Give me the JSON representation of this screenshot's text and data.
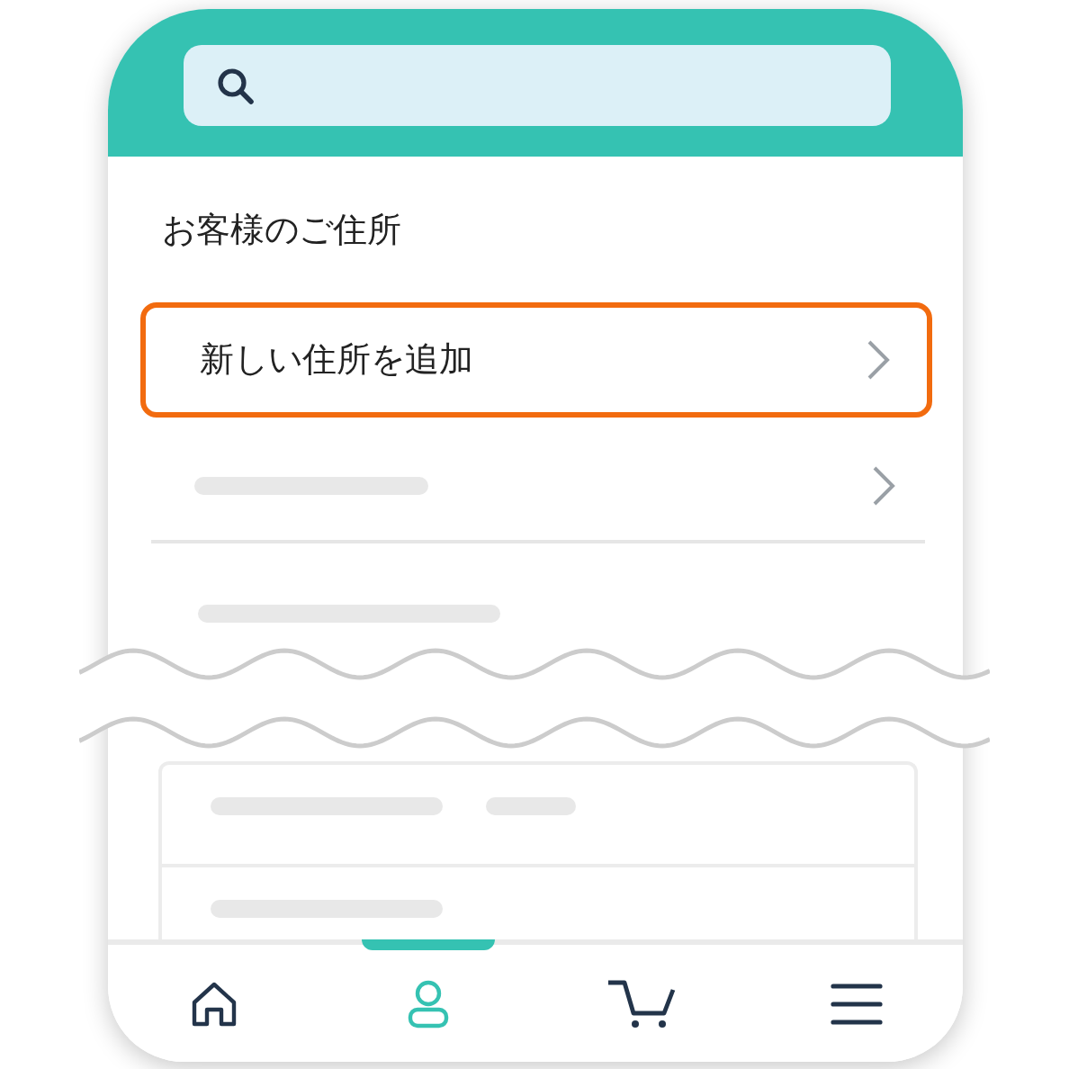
{
  "section_title": "お客様のご住所",
  "add_address_row": {
    "label": "新しい住所を追加",
    "highlighted": true
  },
  "bottom_nav": [
    {
      "kind": "home",
      "selected": false
    },
    {
      "kind": "account",
      "selected": true
    },
    {
      "kind": "cart",
      "selected": false
    },
    {
      "kind": "menu",
      "selected": false
    }
  ]
}
